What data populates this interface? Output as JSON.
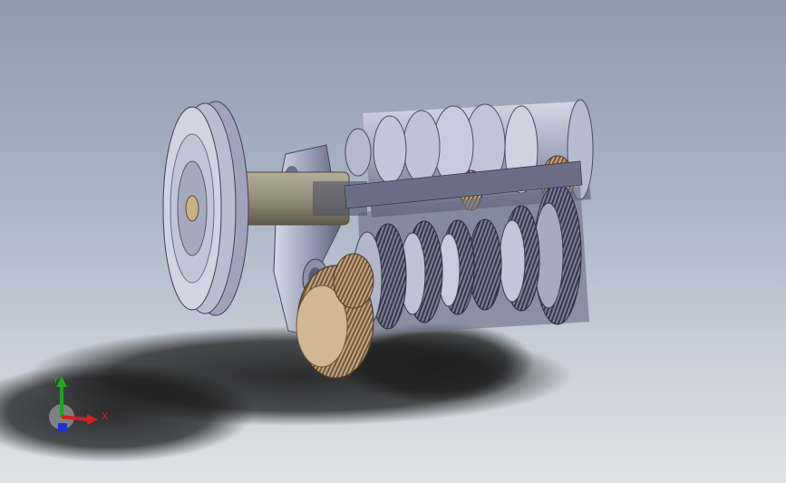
{
  "viewport": {
    "background_top": "#8e9bad",
    "background_bottom": "#dfe3e8"
  },
  "model": {
    "icon": "gearbox-assembly-3d",
    "colors": {
      "metal_light": "#c8ccdc",
      "metal_mid": "#8e92ac",
      "metal_dark": "#4a4d63",
      "shaft_olive": "#8f8a78",
      "bronze": "#b4906a",
      "shadow": "#1b1b1b"
    }
  },
  "triad": {
    "x_label": "X",
    "y_label": "Y",
    "x_color": "#d22020",
    "y_color": "#1fa51f",
    "z_color": "#1f33d0"
  }
}
